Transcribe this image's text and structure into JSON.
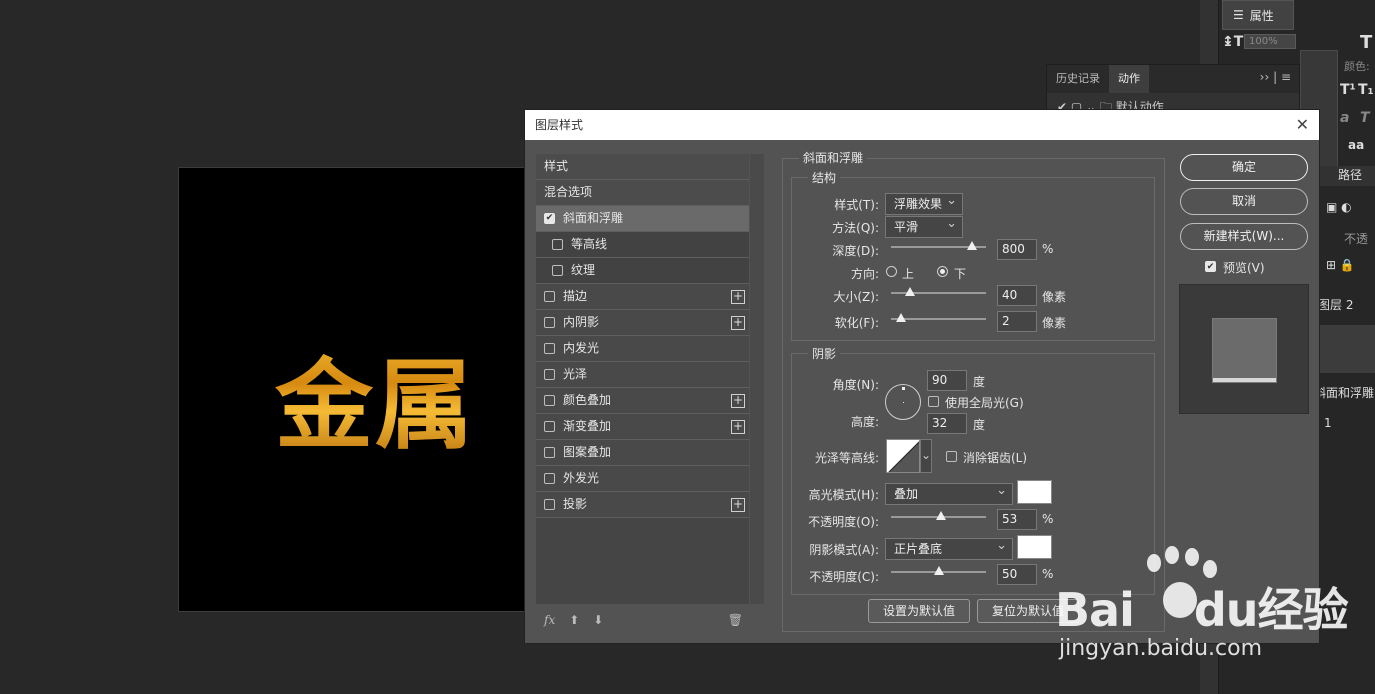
{
  "canvas": {
    "text": "金属"
  },
  "right_panel": {
    "properties_label": "属性",
    "zoom": "100%",
    "color_label": "颜色:",
    "paths_tab": "路径",
    "opacity_label": "不透",
    "layer_name": "图层 2",
    "effect_name": "斜面和浮雕",
    "layer_1": "1"
  },
  "history_panel": {
    "tabs": [
      "历史记录",
      "动作"
    ],
    "row": "默认动作"
  },
  "dialog": {
    "title": "图层样式",
    "styles_list": [
      {
        "label": "样式",
        "type": "header"
      },
      {
        "label": "混合选项",
        "type": "header"
      },
      {
        "label": "斜面和浮雕",
        "checked": true
      },
      {
        "label": "等高线",
        "sub": true
      },
      {
        "label": "纹理",
        "sub": true
      },
      {
        "label": "描边",
        "plus": true
      },
      {
        "label": "内阴影",
        "plus": true
      },
      {
        "label": "内发光"
      },
      {
        "label": "光泽"
      },
      {
        "label": "颜色叠加",
        "plus": true
      },
      {
        "label": "渐变叠加",
        "plus": true
      },
      {
        "label": "图案叠加"
      },
      {
        "label": "外发光"
      },
      {
        "label": "投影",
        "plus": true
      }
    ],
    "fx_label": "fx",
    "bevel": {
      "section_title": "斜面和浮雕",
      "structure_title": "结构",
      "style_label": "样式(T):",
      "style_value": "浮雕效果",
      "technique_label": "方法(Q):",
      "technique_value": "平滑",
      "depth_label": "深度(D):",
      "depth_value": "800",
      "depth_unit": "%",
      "depth_pos": 0.85,
      "direction_label": "方向:",
      "dir_up": "上",
      "dir_down": "下",
      "size_label": "大小(Z):",
      "size_value": "40",
      "size_unit": "像素",
      "size_pos": 0.2,
      "soften_label": "软化(F):",
      "soften_value": "2",
      "soften_unit": "像素",
      "soften_pos": 0.1
    },
    "shading": {
      "title": "阴影",
      "angle_label": "角度(N):",
      "angle_value": "90",
      "angle_unit": "度",
      "global_light": "使用全局光(G)",
      "altitude_label": "高度:",
      "altitude_value": "32",
      "altitude_unit": "度",
      "gloss_label": "光泽等高线:",
      "antialias": "消除锯齿(L)",
      "highlight_mode_label": "高光模式(H):",
      "highlight_mode": "叠加",
      "highlight_color": "#ffffff",
      "hl_opacity_label": "不透明度(O):",
      "hl_opacity": "53",
      "hl_opacity_pos": 0.53,
      "shadow_mode_label": "阴影模式(A):",
      "shadow_mode": "正片叠底",
      "shadow_color": "#ffffff",
      "sh_opacity_label": "不透明度(C):",
      "sh_opacity": "50",
      "sh_opacity_pos": 0.5,
      "percent": "%"
    },
    "set_default": "设置为默认值",
    "reset_default": "复位为默认值",
    "ok": "确定",
    "cancel": "取消",
    "new_style": "新建样式(W)...",
    "preview_label": "预览(V)"
  },
  "watermark": {
    "logo_a": "Bai",
    "logo_b": "du",
    "logo_c": "经验",
    "url": "jingyan.baidu.com"
  }
}
